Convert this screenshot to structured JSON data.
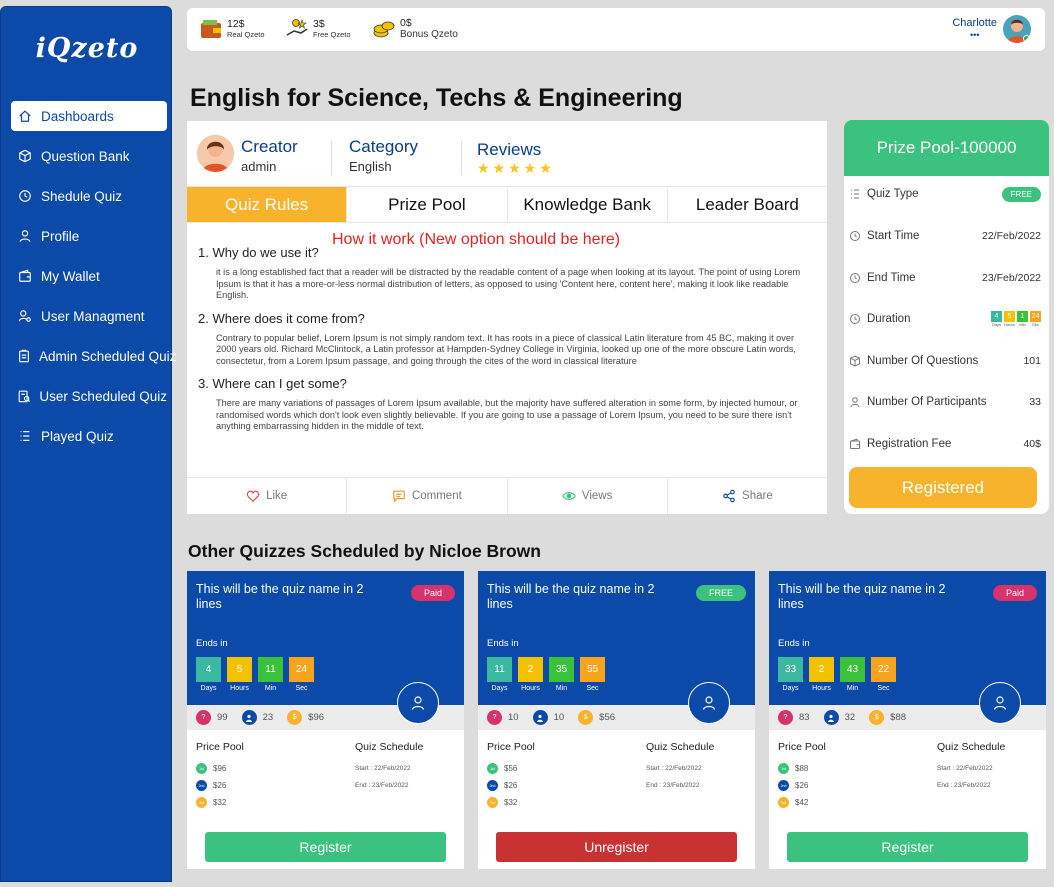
{
  "app": {
    "logo": "iQzeto"
  },
  "sidebar": {
    "items": [
      {
        "label": "Dashboards",
        "icon": "home-icon",
        "active": true
      },
      {
        "label": "Question Bank",
        "icon": "cube-icon"
      },
      {
        "label": "Shedule Quiz",
        "icon": "clock-icon"
      },
      {
        "label": "Profile",
        "icon": "user-icon"
      },
      {
        "label": "My Wallet",
        "icon": "wallet-icon"
      },
      {
        "label": "User Managment",
        "icon": "user-gear-icon"
      },
      {
        "label": "Admin Scheduled Quiz",
        "icon": "clipboard-icon"
      },
      {
        "label": "User Scheduled Quiz",
        "icon": "clipboard-search-icon"
      },
      {
        "label": "Played Quiz",
        "icon": "list-icon"
      }
    ]
  },
  "topbar": {
    "wallets": [
      {
        "amount": "12$",
        "label": "Real Qzeto"
      },
      {
        "amount": "3$",
        "label": "Free Qzeto"
      },
      {
        "amount": "0$",
        "label": "Bonus Qzeto"
      }
    ],
    "user": {
      "name": "Charlotte",
      "dots": "•••"
    }
  },
  "page": {
    "title": "English for Science, Techs & Engineering"
  },
  "quiz_info": {
    "creator_label": "Creator",
    "creator_value": "admin",
    "category_label": "Category",
    "category_value": "English",
    "reviews_label": "Reviews",
    "stars": "★★★★★"
  },
  "tabs": [
    "Quiz Rules",
    "Prize Pool",
    "Knowledge Bank",
    "Leader Board"
  ],
  "note": "How it work (New option should be here)",
  "rules": [
    {
      "q": "1. Why do we use it?",
      "a": "it is a long established fact that a reader will be distracted by the readable content of a page when looking at its layout. The point of using Lorem Ipsum is that it has a more-or-less normal distribution of letters, as opposed to using 'Content here, content here', making it look like readable English."
    },
    {
      "q": "2. Where does it come from?",
      "a": "Contrary to popular belief, Lorem Ipsum is not simply random text. It has roots in a piece of classical Latin literature from 45 BC, making it over 2000 years old. Richard McClintock, a Latin professor at Hampden-Sydney College in Virginia, looked up one of the more obscure Latin words, consectetur, from a Lorem Ipsum passage, and going through the cites of the word in classical literature"
    },
    {
      "q": "3. Where can I get some?",
      "a": "There are many variations of passages of Lorem Ipsum available, but the majority have suffered alteration in some form, by injected humour, or randomised words which don't look even slightly believable. If you are going to use a passage of Lorem Ipsum, you need to be sure there isn't anything embarrassing hidden in the middle of text."
    }
  ],
  "actions": [
    "Like",
    "Comment",
    "Views",
    "Share"
  ],
  "prize": {
    "title": "Prize Pool-100000",
    "quiz_type_label": "Quiz Type",
    "quiz_type_value": "FREE",
    "start_label": "Start Time",
    "start_value": "22/Feb/2022",
    "end_label": "End Time",
    "end_value": "23/Feb/2022",
    "duration_label": "Duration",
    "duration": [
      {
        "v": "4",
        "u": "Days",
        "color": "#3bb9a0"
      },
      {
        "v": "5",
        "u": "Hours",
        "color": "#f2c200"
      },
      {
        "v": "1",
        "u": "Min",
        "color": "#3bc23b"
      },
      {
        "v": "24",
        "u": "Sec",
        "color": "#f7a31b"
      }
    ],
    "questions_label": "Number Of Questions",
    "questions_value": "101",
    "participants_label": "Number Of Participants",
    "participants_value": "33",
    "fee_label": "Registration Fee",
    "fee_value": "40$",
    "button": "Registered"
  },
  "other": {
    "title": "Other Quizzes Scheduled by Nicloe Brown",
    "ends_label": "Ends in",
    "pp_label": "Price Pool",
    "qs_label": "Quiz Schedule",
    "cards": [
      {
        "name": "This will be the quiz name in 2 lines",
        "badge": "Paid",
        "timer": [
          {
            "v": "4",
            "u": "Days"
          },
          {
            "v": "5",
            "u": "Hours"
          },
          {
            "v": "11",
            "u": "Min"
          },
          {
            "v": "24",
            "u": "Sec"
          }
        ],
        "stats": [
          "99",
          "23",
          "$96"
        ],
        "prizes": [
          {
            "rank": "1st",
            "amt": "$96"
          },
          {
            "rank": "2nd",
            "amt": "$26"
          },
          {
            "rank": "3rd",
            "amt": "$32"
          }
        ],
        "start": "Start : 22/Feb/2022",
        "end": "End : 23/Feb/2022",
        "button": "Register"
      },
      {
        "name": "This will be the quiz name in 2 lines",
        "badge": "FREE",
        "timer": [
          {
            "v": "11",
            "u": "Days"
          },
          {
            "v": "2",
            "u": "Hours"
          },
          {
            "v": "35",
            "u": "Min"
          },
          {
            "v": "55",
            "u": "Sec"
          }
        ],
        "stats": [
          "10",
          "10",
          "$56"
        ],
        "prizes": [
          {
            "rank": "1st",
            "amt": "$56"
          },
          {
            "rank": "2nd",
            "amt": "$26"
          },
          {
            "rank": "3rd",
            "amt": "$32"
          }
        ],
        "start": "Start : 22/Feb/2022",
        "end": "End : 23/Feb/2022",
        "button": "Unregister"
      },
      {
        "name": "This will be the quiz name in 2 lines",
        "badge": "Paid",
        "timer": [
          {
            "v": "33",
            "u": "Days"
          },
          {
            "v": "2",
            "u": "Hours"
          },
          {
            "v": "43",
            "u": "Min"
          },
          {
            "v": "22",
            "u": "Sec"
          }
        ],
        "stats": [
          "83",
          "32",
          "$88"
        ],
        "prizes": [
          {
            "rank": "1st",
            "amt": "$88"
          },
          {
            "rank": "2nd",
            "amt": "$26"
          },
          {
            "rank": "3rd",
            "amt": "$42"
          }
        ],
        "start": "Start : 22/Feb/2022",
        "end": "End : 23/Feb/2022",
        "button": "Register"
      }
    ]
  },
  "colors": {
    "primary": "#0b4aa8",
    "accent_orange": "#f7b32b",
    "green": "#3bc27f",
    "red": "#c83232",
    "paid_pink": "#d6336c",
    "timer": [
      "#3bb9a0",
      "#f2c200",
      "#3bc23b",
      "#f7a31b"
    ]
  }
}
